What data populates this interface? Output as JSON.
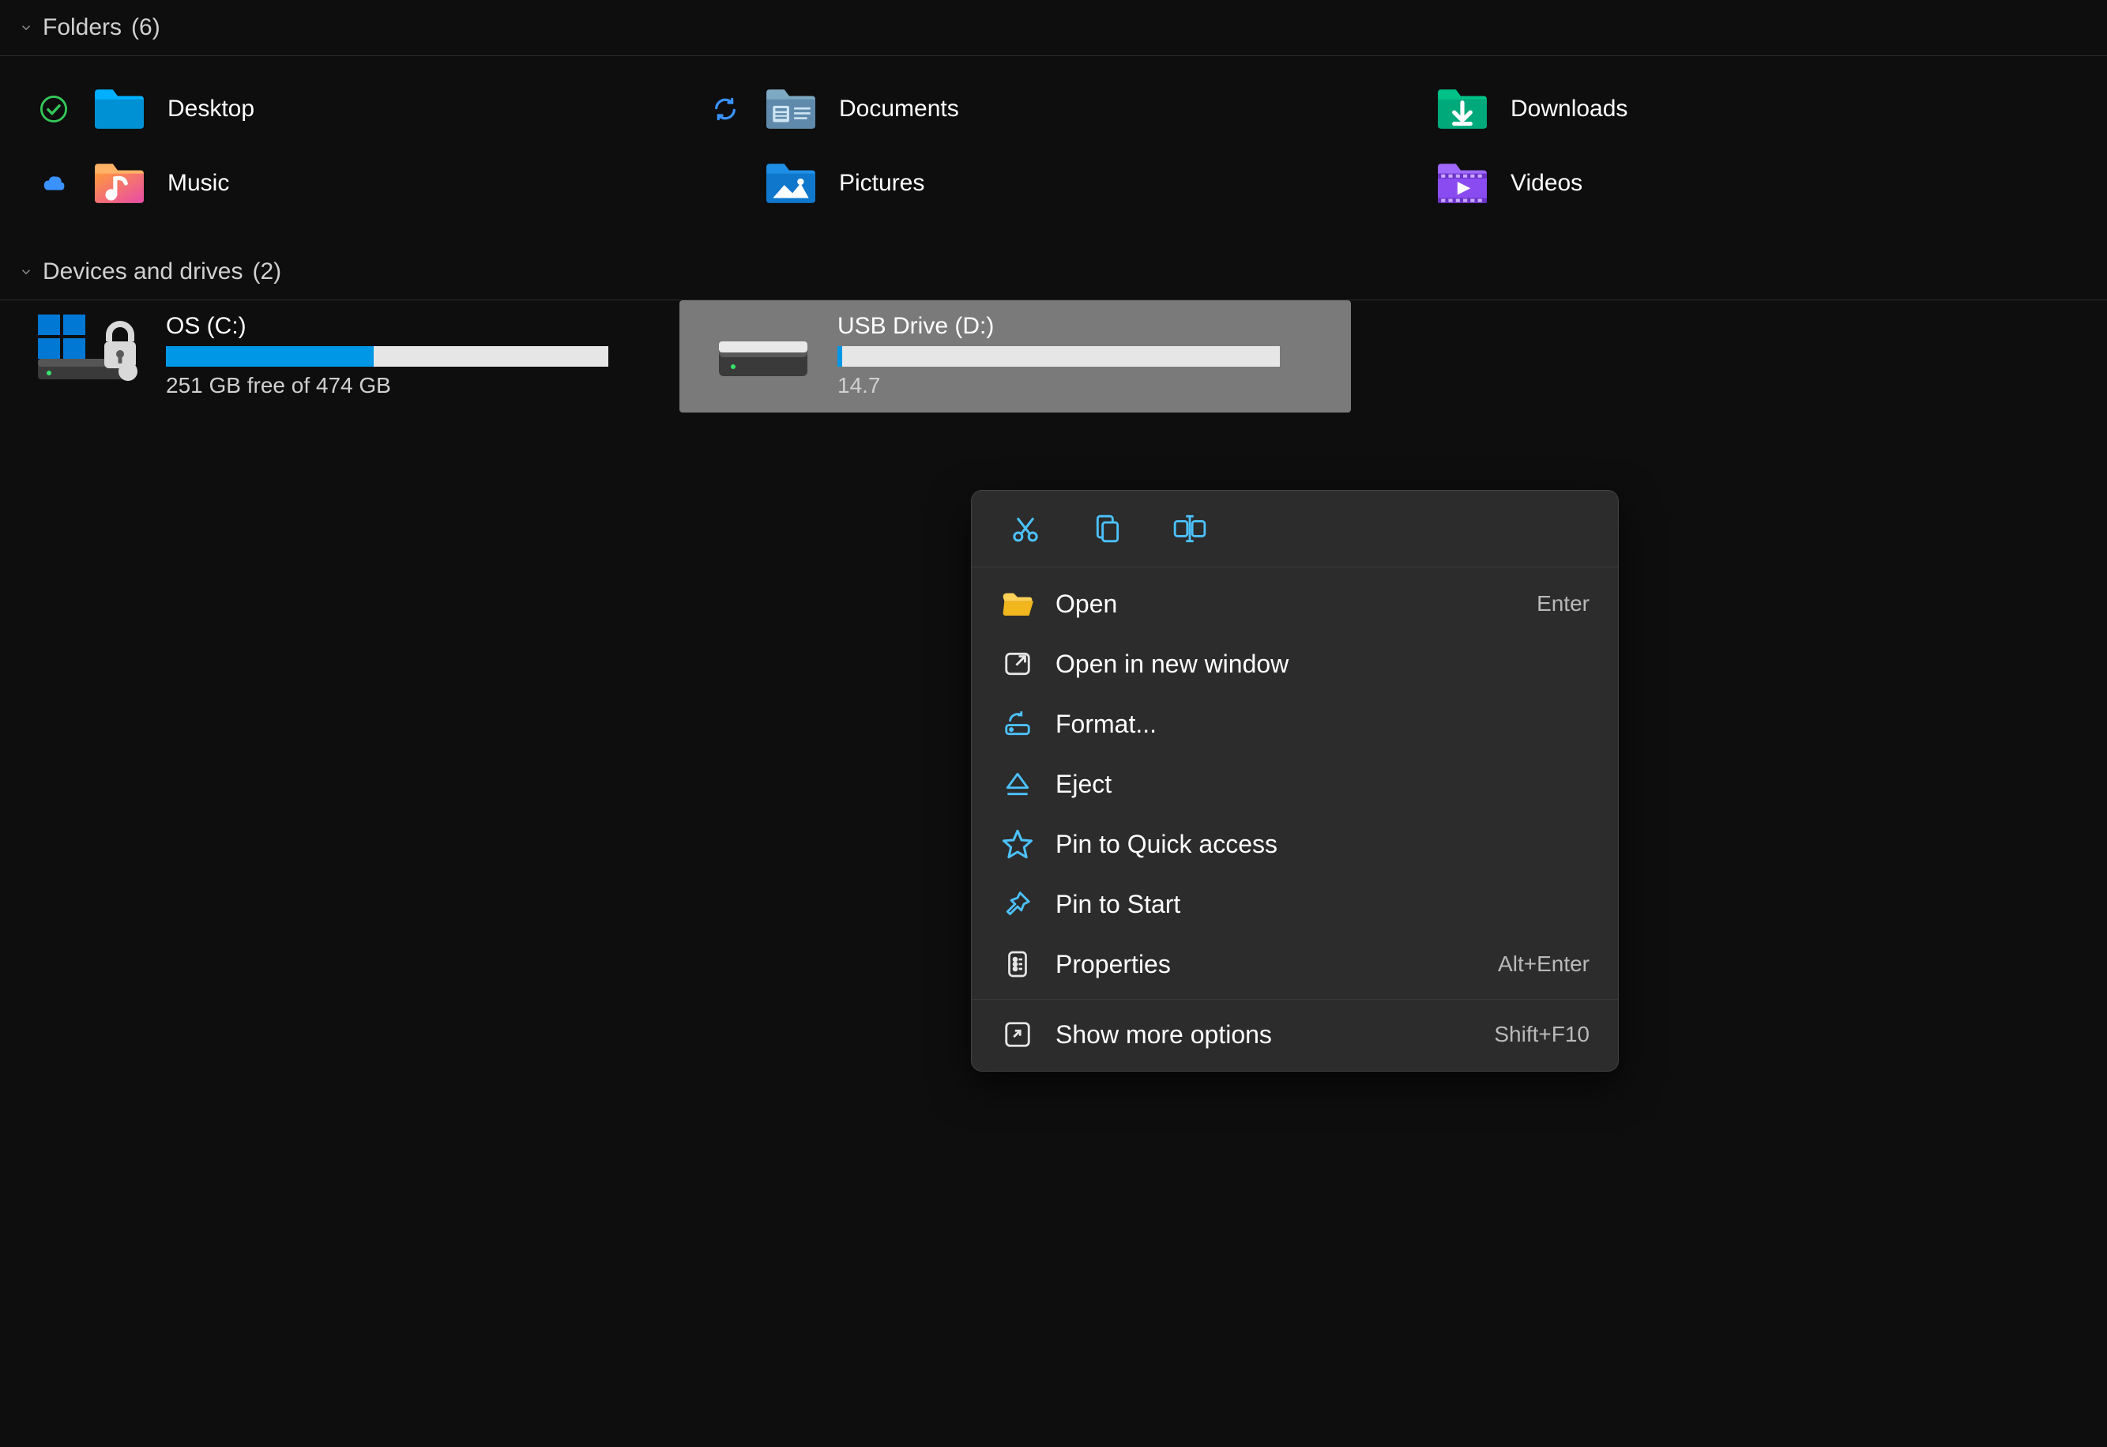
{
  "sections": {
    "folders": {
      "title": "Folders",
      "count": "(6)",
      "items": [
        {
          "label": "Desktop",
          "status": "synced"
        },
        {
          "label": "Documents",
          "status": "sync"
        },
        {
          "label": "Downloads",
          "status": ""
        },
        {
          "label": "Music",
          "status": "cloud"
        },
        {
          "label": "Pictures",
          "status": ""
        },
        {
          "label": "Videos",
          "status": ""
        }
      ]
    },
    "drives": {
      "title": "Devices and drives",
      "count": "(2)",
      "items": [
        {
          "name": "OS (C:)",
          "sub": "251 GB free of 474 GB",
          "fill_pct": 47,
          "selected": false
        },
        {
          "name": "USB Drive (D:)",
          "sub": "14.7",
          "fill_pct": 1,
          "selected": true
        }
      ]
    }
  },
  "context_menu": {
    "items": [
      {
        "icon": "folder-open",
        "label": "Open",
        "shortcut": "Enter"
      },
      {
        "icon": "open-new",
        "label": "Open in new window",
        "shortcut": ""
      },
      {
        "icon": "format",
        "label": "Format...",
        "shortcut": ""
      },
      {
        "icon": "eject",
        "label": "Eject",
        "shortcut": ""
      },
      {
        "icon": "star",
        "label": "Pin to Quick access",
        "shortcut": ""
      },
      {
        "icon": "pin",
        "label": "Pin to Start",
        "shortcut": ""
      },
      {
        "icon": "properties",
        "label": "Properties",
        "shortcut": "Alt+Enter"
      },
      {
        "icon": "more",
        "label": "Show more options",
        "shortcut": "Shift+F10"
      }
    ]
  }
}
